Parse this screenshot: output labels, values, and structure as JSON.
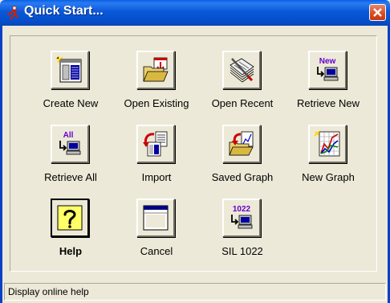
{
  "window": {
    "title": "Quick Start..."
  },
  "tiles": [
    {
      "label": "Create New"
    },
    {
      "label": "Open Existing"
    },
    {
      "label": "Open Recent"
    },
    {
      "label": "Retrieve New",
      "icon_text": "New"
    },
    {
      "label": "Retrieve All",
      "icon_text": "All"
    },
    {
      "label": "Import"
    },
    {
      "label": "Saved Graph"
    },
    {
      "label": "New Graph"
    },
    {
      "label": "Help"
    },
    {
      "label": "Cancel"
    },
    {
      "label": "SIL 1022",
      "icon_text": "1022"
    }
  ],
  "status_bar": {
    "text": "Display online help"
  },
  "colors": {
    "title_bar": "#0a58d8",
    "close_button": "#d84a21",
    "dialog_bg": "#ece9d8",
    "icon_text": "#6600cc"
  }
}
